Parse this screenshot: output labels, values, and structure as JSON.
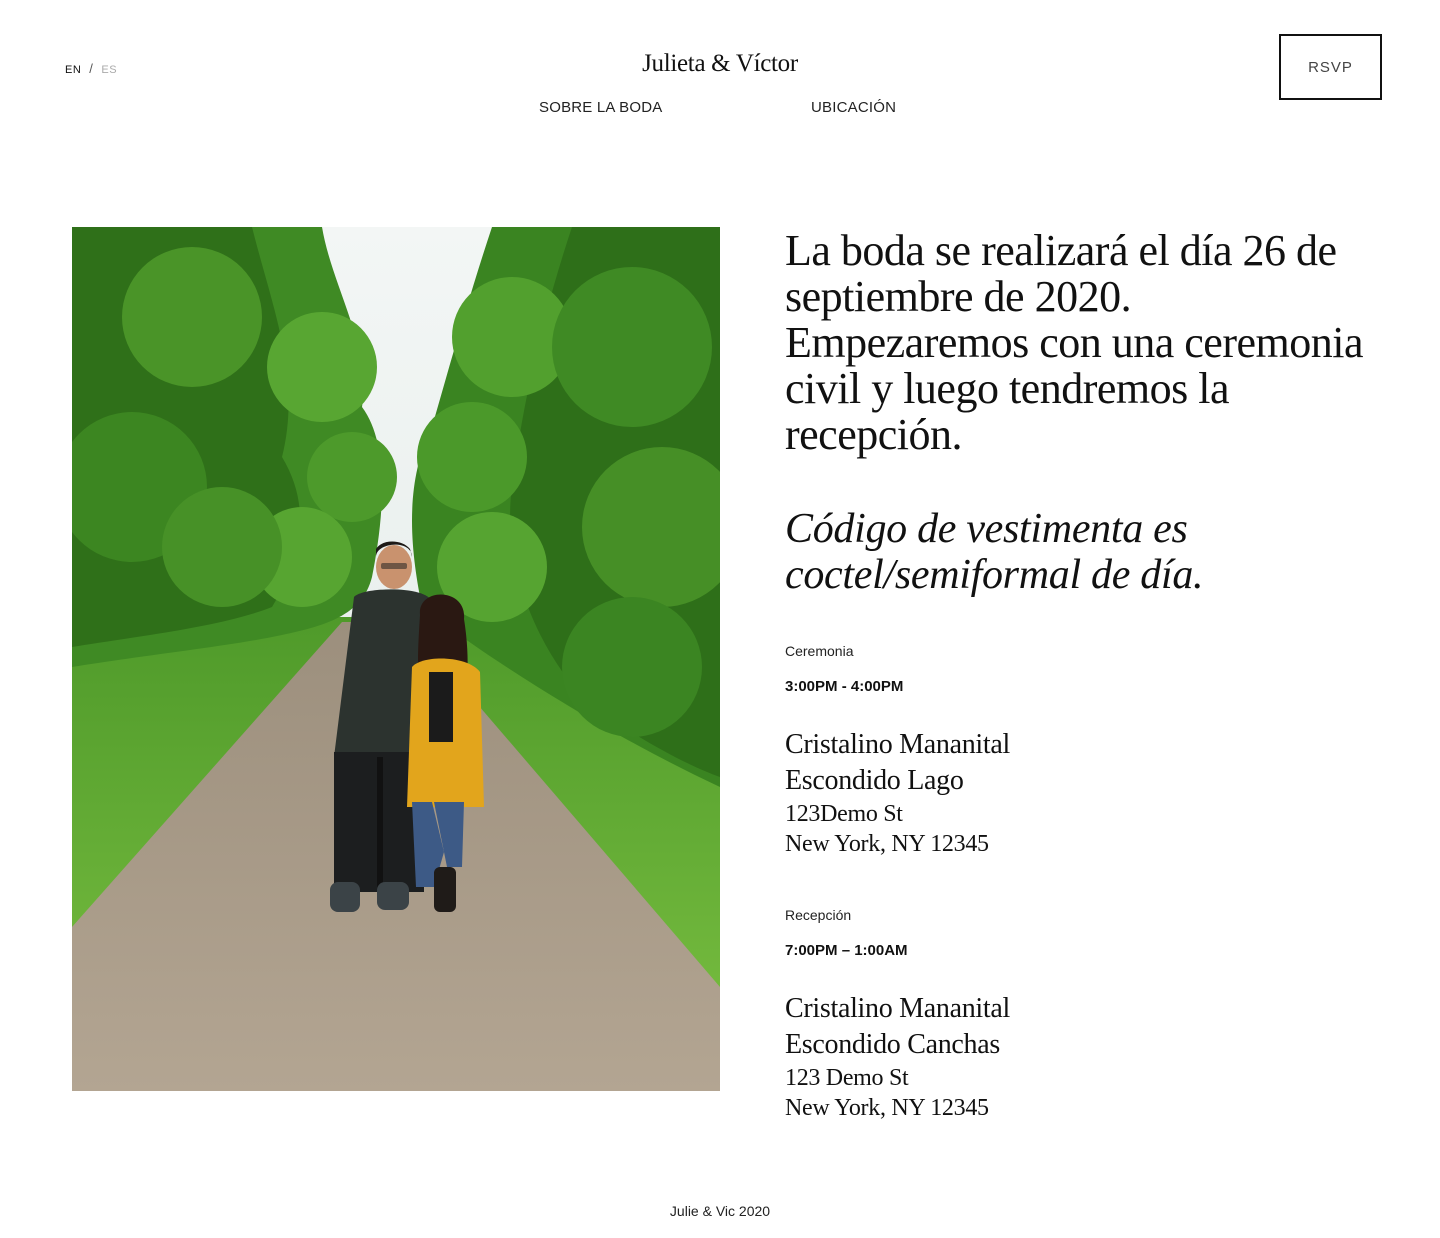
{
  "header": {
    "lang_en": "EN",
    "lang_sep": "/",
    "lang_es": "ES",
    "brand": "Julieta & Víctor",
    "rsvp_label": "RSVP"
  },
  "nav": {
    "items": [
      {
        "label": "SOBRE LA BODA"
      },
      {
        "label": "UBICACIÓN"
      }
    ]
  },
  "main": {
    "intro": "La boda se realizará el día 26 de septiembre de 2020. Empezaremos con una ceremonia civil y luego tendremos la recepción.",
    "dress_code": "Código de vestimenta es coctel/semiformal de día.",
    "ceremony": {
      "label": "Ceremonia",
      "time": "3:00PM - 4:00PM",
      "venue_line1": "Cristalino Mananital",
      "venue_line2": "Escondido Lago",
      "address_line1": "123Demo St",
      "address_line2": "New York, NY 12345"
    },
    "reception": {
      "label": "Recepción",
      "time": "7:00PM – 1:00AM",
      "venue_line1": "Cristalino Mananital",
      "venue_line2": "Escondido Canchas",
      "address_line1": "123 Demo St",
      "address_line2": "New York, NY 12345"
    }
  },
  "footer": {
    "text": "Julie & Vic 2020"
  },
  "colors": {
    "foliage_dark": "#2f6e1d",
    "foliage_light": "#5fb032",
    "grass": "#6fb43a",
    "path": "#a89a88",
    "sky": "#eef3f2",
    "jacket_yellow": "#e2a51c",
    "jacket_dark": "#2a302d"
  }
}
